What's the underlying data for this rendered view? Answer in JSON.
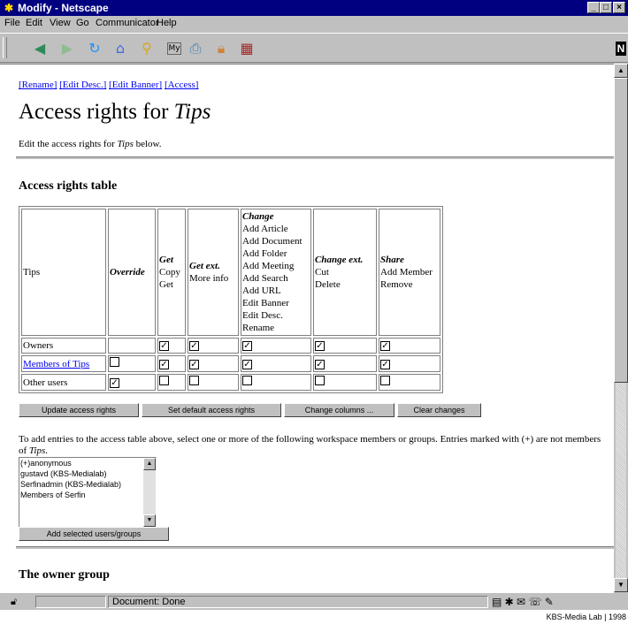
{
  "window": {
    "title": "Modify - Netscape"
  },
  "menu": [
    "File",
    "Edit",
    "View",
    "Go",
    "Communicator",
    "Help"
  ],
  "toolbar_icons": [
    "back-icon",
    "forward-icon",
    "reload-icon",
    "home-icon",
    "search-icon",
    "my-netscape-icon",
    "print-icon",
    "security-icon",
    "stop-icon"
  ],
  "nav_links": [
    "[Rename]",
    "[Edit Desc.]",
    "[Edit Banner]",
    "[Access]"
  ],
  "page": {
    "title_prefix": "Access rights for ",
    "title_item": "Tips",
    "intro_prefix": "Edit the access rights for ",
    "intro_item": "Tips",
    "intro_suffix": " below.",
    "section1": "Access rights table",
    "section2": "The owner group"
  },
  "table": {
    "corner": "Tips",
    "headers": [
      {
        "title": "Override",
        "items": []
      },
      {
        "title": "Get",
        "items": [
          "Copy",
          "Get"
        ]
      },
      {
        "title": "Get ext.",
        "items": [
          "More info"
        ]
      },
      {
        "title": "Change",
        "items": [
          "Add Article",
          "Add Document",
          "Add Folder",
          "Add Meeting",
          "Add Search",
          "Add URL",
          "Edit Banner",
          "Edit Desc.",
          "Rename"
        ]
      },
      {
        "title": "Change ext.",
        "items": [
          "Cut",
          "Delete"
        ]
      },
      {
        "title": "Share",
        "items": [
          "Add Member",
          "Remove"
        ]
      }
    ],
    "rows": [
      {
        "label": "Owners",
        "link": false,
        "checks": [
          null,
          true,
          true,
          true,
          true,
          true
        ]
      },
      {
        "label": "Members of Tips",
        "link": true,
        "checks": [
          false,
          true,
          true,
          true,
          true,
          true
        ]
      },
      {
        "label": "Other users",
        "link": false,
        "checks": [
          true,
          false,
          false,
          false,
          false,
          false
        ]
      }
    ]
  },
  "buttons": {
    "update": "Update access rights",
    "set_default": "Set default access rights",
    "change_columns": "Change columns ...",
    "clear": "Clear changes",
    "add_selected": "Add selected users/groups"
  },
  "add_text": {
    "part1": "To add entries to the access table above, select one or more of the following workspace members or groups. Entries marked with (+) are not members of ",
    "item": "Tips",
    "part2": "."
  },
  "members_list": [
    "(+)anonymous",
    "gustavd (KBS-Medialab)",
    "Serfinadmin (KBS-Medialab)",
    "Members of Serfin"
  ],
  "status": {
    "message": "Document: Done"
  },
  "credit": "KBS-Media Lab | 1998"
}
